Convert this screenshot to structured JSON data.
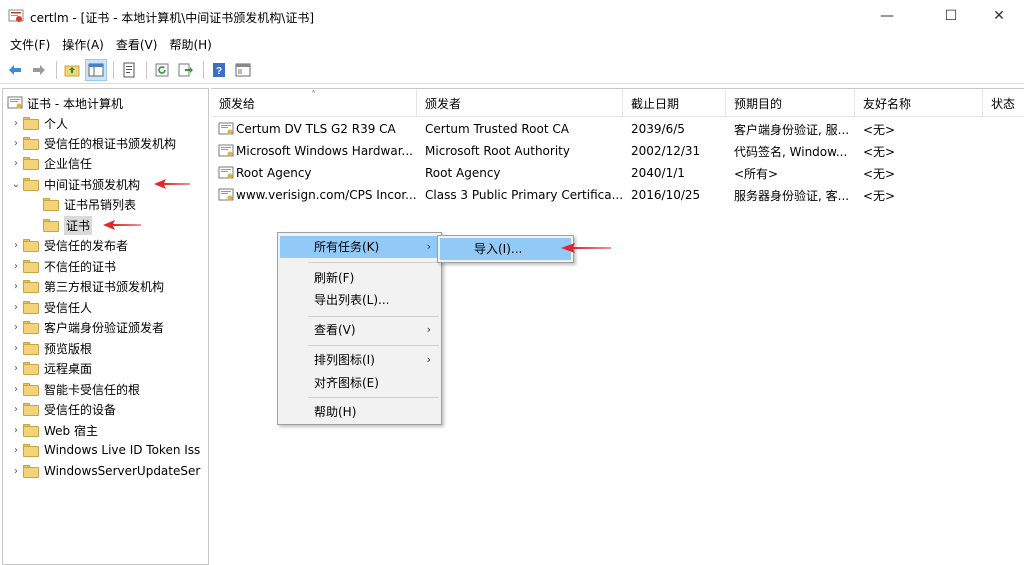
{
  "window": {
    "app_name": "certlm",
    "title": "certlm - [证书 - 本地计算机\\中间证书颁发机构\\证书]",
    "minimize": "—",
    "maximize": "☐",
    "close": "✕"
  },
  "menubar": {
    "items": [
      "文件(F)",
      "操作(A)",
      "查看(V)",
      "帮助(H)"
    ]
  },
  "toolbar": {
    "buttons": [
      "back-icon",
      "forward-icon",
      "up-folder-icon",
      "show-tree-icon",
      "properties-icon",
      "refresh-icon",
      "export-icon",
      "help-icon",
      "view-icon"
    ]
  },
  "tree": {
    "root": "证书 - 本地计算机",
    "items": [
      {
        "label": "个人"
      },
      {
        "label": "受信任的根证书颁发机构"
      },
      {
        "label": "企业信任"
      },
      {
        "label": "中间证书颁发机构"
      },
      {
        "label": "证书吊销列表"
      },
      {
        "label": "证书"
      },
      {
        "label": "受信任的发布者"
      },
      {
        "label": "不信任的证书"
      },
      {
        "label": "第三方根证书颁发机构"
      },
      {
        "label": "受信任人"
      },
      {
        "label": "客户端身份验证颁发者"
      },
      {
        "label": "预览版根"
      },
      {
        "label": "远程桌面"
      },
      {
        "label": "智能卡受信任的根"
      },
      {
        "label": "受信任的设备"
      },
      {
        "label": "Web 宿主"
      },
      {
        "label": "Windows Live ID Token Iss"
      },
      {
        "label": "WindowsServerUpdateSer"
      }
    ]
  },
  "list": {
    "columns": [
      "颁发给",
      "颁发者",
      "截止日期",
      "预期目的",
      "友好名称",
      "状态"
    ],
    "rows": [
      {
        "issued_to": "Certum DV TLS G2 R39 CA",
        "issuer": "Certum Trusted Root CA",
        "expires": "2039/6/5",
        "purpose": "客户端身份验证, 服...",
        "friendly": "<无>"
      },
      {
        "issued_to": "Microsoft Windows Hardwar...",
        "issuer": "Microsoft Root Authority",
        "expires": "2002/12/31",
        "purpose": "代码签名, Window...",
        "friendly": "<无>"
      },
      {
        "issued_to": "Root Agency",
        "issuer": "Root Agency",
        "expires": "2040/1/1",
        "purpose": "<所有>",
        "friendly": "<无>"
      },
      {
        "issued_to": "www.verisign.com/CPS Incor...",
        "issuer": "Class 3 Public Primary Certifica...",
        "expires": "2016/10/25",
        "purpose": "服务器身份验证, 客...",
        "friendly": "<无>"
      }
    ]
  },
  "context_menu": {
    "all_tasks": "所有任务(K)",
    "refresh": "刷新(F)",
    "export_list": "导出列表(L)...",
    "view": "查看(V)",
    "arrange_icons": "排列图标(I)",
    "line_up_icons": "对齐图标(E)",
    "help": "帮助(H)"
  },
  "submenu": {
    "import": "导入(I)..."
  },
  "colors": {
    "highlight": "#91c9f7",
    "annotation_arrow": "#e0282b"
  }
}
